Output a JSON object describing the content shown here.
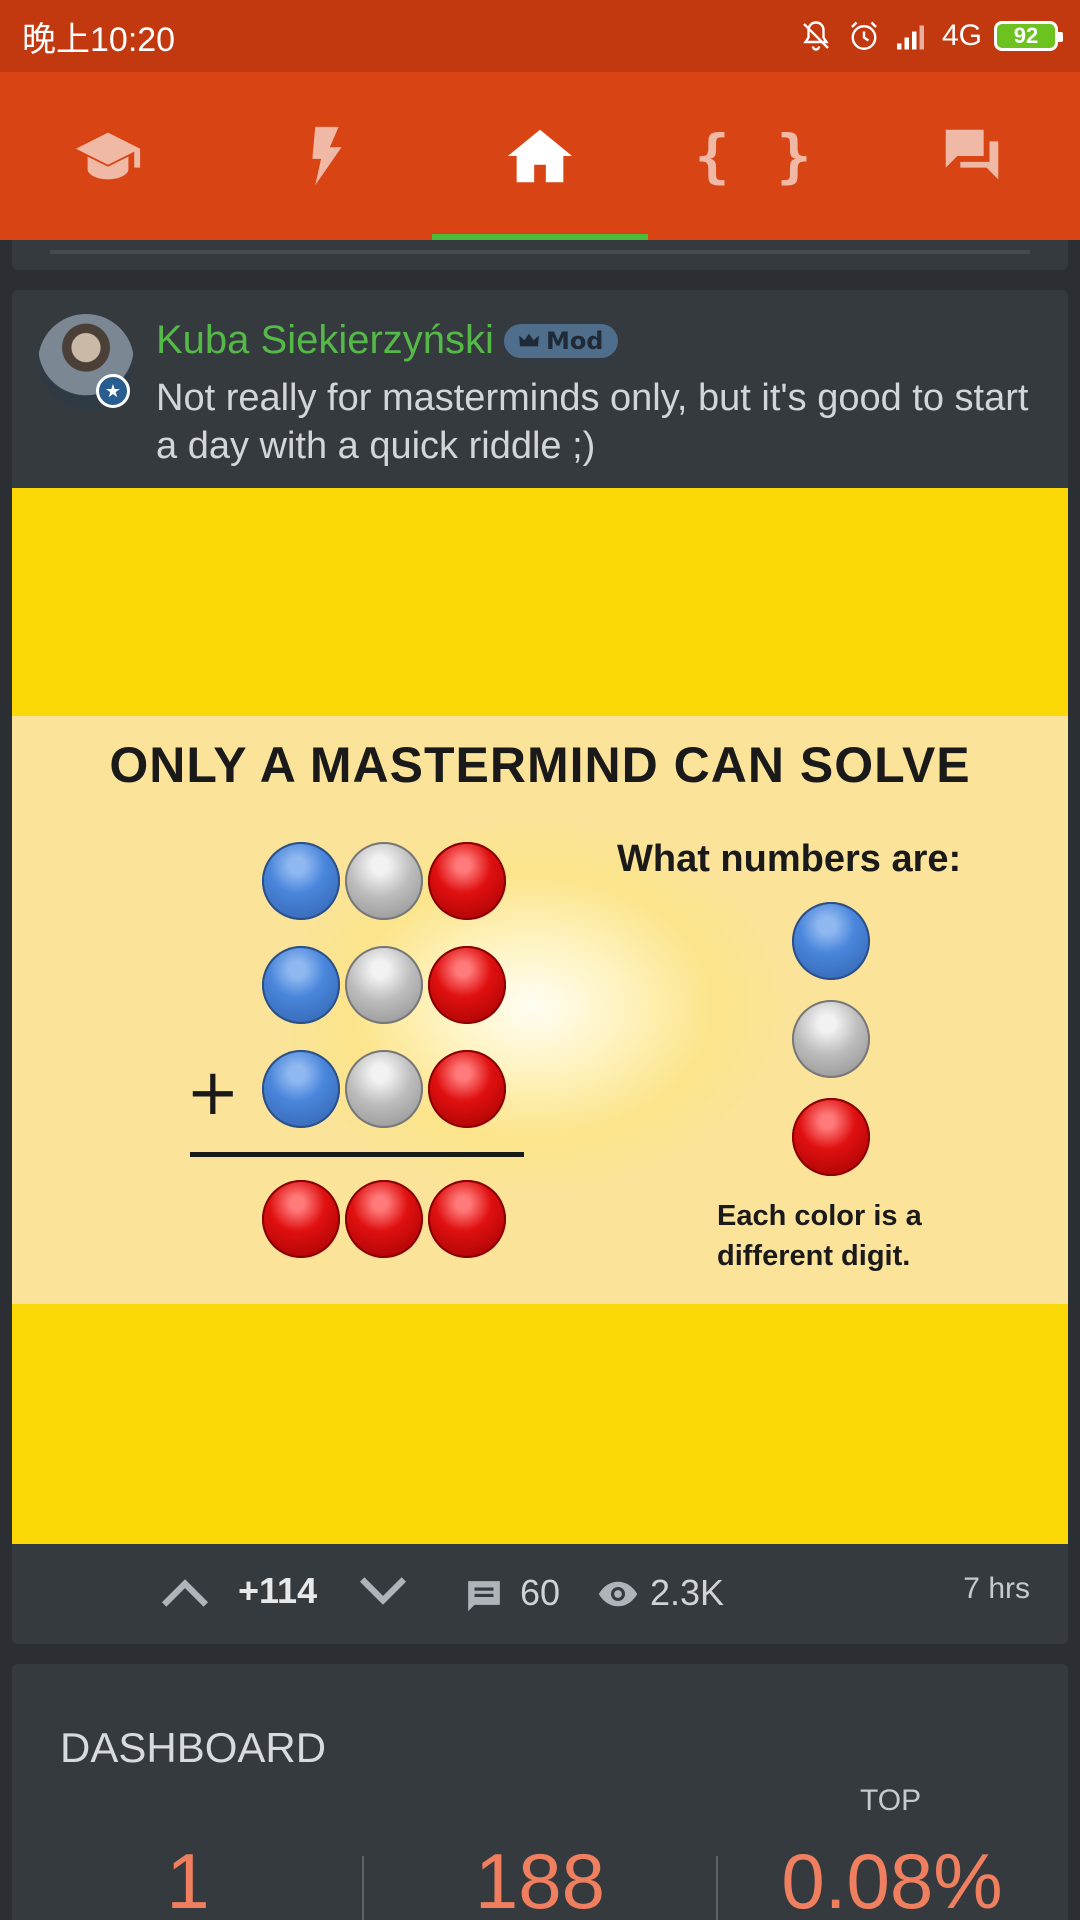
{
  "status_bar": {
    "time": "晚上10:20",
    "network": "4G",
    "battery": "92"
  },
  "nav": {
    "tabs": [
      {
        "icon": "graduation-cap-icon",
        "active": false
      },
      {
        "icon": "lightning-icon",
        "active": false
      },
      {
        "icon": "home-icon",
        "active": true
      },
      {
        "icon": "code-braces-icon",
        "label": "{ }",
        "active": false
      },
      {
        "icon": "chat-icon",
        "active": false
      }
    ]
  },
  "post": {
    "author": "Kuba Siekierzyński",
    "badge": "Mod",
    "text": "Not really for masterminds only, but it's good to start a day with a quick riddle ;)",
    "image": {
      "title": "ONLY A MASTERMIND CAN SOLVE",
      "question": "What numbers are:",
      "note": "Each color is a different digit.",
      "plus": "+"
    },
    "score": "+114",
    "comments": "60",
    "views": "2.3K",
    "time": "7 hrs"
  },
  "dashboard": {
    "title": "DASHBOARD",
    "top_label": "TOP",
    "stats": [
      "1",
      "188",
      "0.08%"
    ]
  },
  "colors": {
    "status_bar": "#c2380f",
    "nav": "#d94414",
    "active_indicator": "#4cbb3a",
    "author": "#54b947",
    "stat": "#f07f5f",
    "image_bg": "#fcd906"
  }
}
